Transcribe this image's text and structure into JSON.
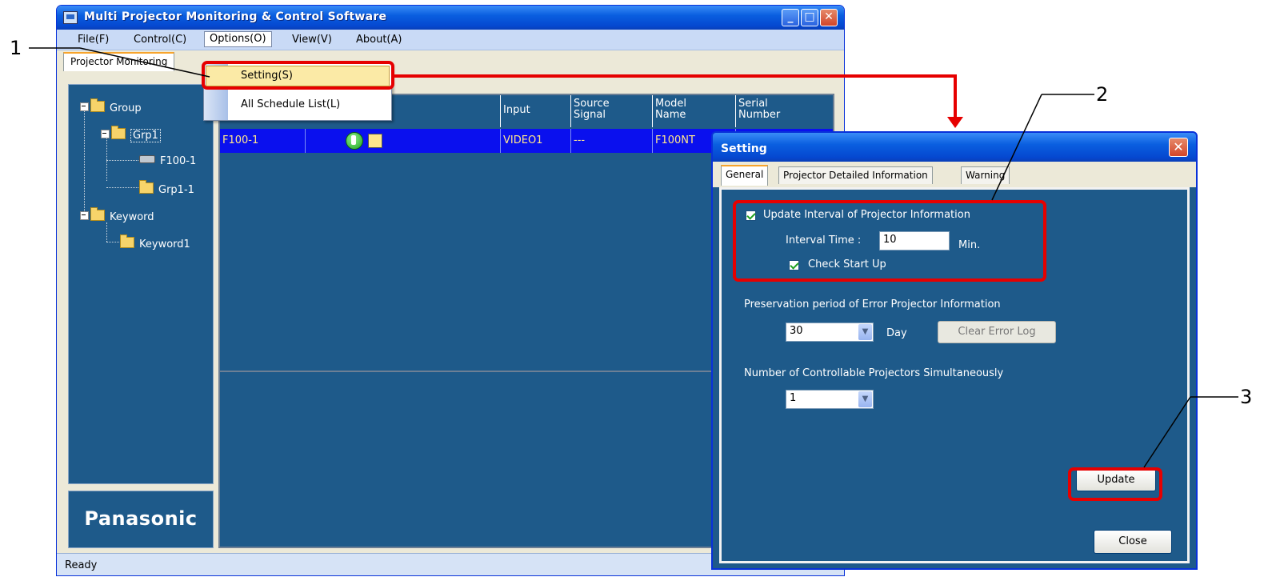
{
  "main_window": {
    "title": "Multi Projector Monitoring & Control Software",
    "menu": [
      "File(F)",
      "Control(C)",
      "Options(O)",
      "View(V)",
      "About(A)"
    ],
    "tab": "Projector Monitoring",
    "tree": {
      "group": "Group",
      "grp1": "Grp1",
      "f100": "F100-1",
      "grp1_1": "Grp1-1",
      "keyword": "Keyword",
      "keyword1": "Keyword1"
    },
    "columns": {
      "input": "Input",
      "source_signal": "Source\nSignal",
      "model_name": "Model\nName",
      "serial_number": "Serial\nNumber"
    },
    "row": {
      "name": "F100-1",
      "input": "VIDEO1",
      "source": "---",
      "model": "F100NT"
    },
    "logo": "Panasonic",
    "status": "Ready"
  },
  "options_menu": {
    "items": [
      "Setting(S)",
      "All Schedule List(L)"
    ]
  },
  "setting_dialog": {
    "title": "Setting",
    "tabs": [
      "General",
      "Projector Detailed Information",
      "Warning"
    ],
    "update_interval_label": "Update Interval of Projector Information",
    "interval_time_label": "Interval Time :",
    "interval_value": "10",
    "interval_unit": "Min.",
    "check_start_label": "Check Start Up",
    "preservation_label": "Preservation period of  Error Projector Information",
    "preservation_value": "30",
    "day_label": "Day",
    "clear_log_label": "Clear Error Log",
    "controllable_label": "Number of Controllable Projectors Simultaneously",
    "controllable_value": "1",
    "update_button": "Update",
    "close_button": "Close"
  },
  "callouts": [
    "1",
    "2",
    "3"
  ],
  "colors": {
    "highlight": "#e60000",
    "panel": "#1e5a8a",
    "row_selected": "#0a10ee"
  }
}
